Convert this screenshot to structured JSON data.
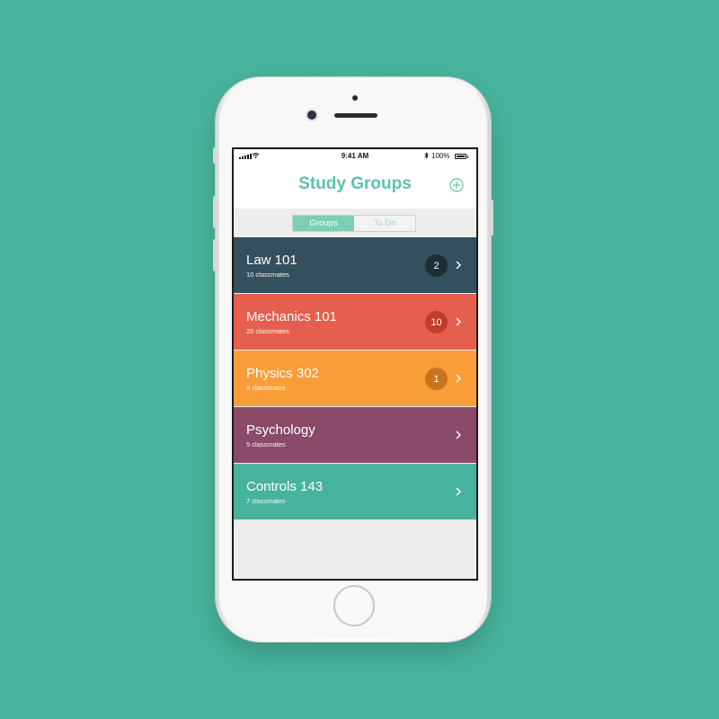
{
  "status_bar": {
    "time": "9:41 AM",
    "battery_percent": "100%",
    "icons": [
      "signal-icon",
      "wifi-icon",
      "bluetooth-icon",
      "battery-icon"
    ]
  },
  "nav": {
    "title": "Study Groups",
    "add_icon": "plus-circle-icon"
  },
  "segmented": {
    "groups_label": "Groups",
    "todo_label": "To Do",
    "selected": "Groups"
  },
  "groups": [
    {
      "name": "Law 101",
      "subtitle": "10 classmates",
      "badge": "2",
      "color": "#34505e",
      "badge_color": "#1d2e36"
    },
    {
      "name": "Mechanics 101",
      "subtitle": "20 classmates",
      "badge": "10",
      "color": "#e65f4e",
      "badge_color": "#c23b2b"
    },
    {
      "name": "Physics 302",
      "subtitle": "9 classmates",
      "badge": "1",
      "color": "#f99d39",
      "badge_color": "#c8741f"
    },
    {
      "name": "Psychology",
      "subtitle": "5 classmates",
      "badge": "",
      "color": "#8b4a68",
      "badge_color": ""
    },
    {
      "name": "Controls 143",
      "subtitle": "7 classmates",
      "badge": "",
      "color": "#48b39c",
      "badge_color": ""
    }
  ],
  "colors": {
    "background": "#48b39c",
    "accent": "#5cc3a5"
  }
}
